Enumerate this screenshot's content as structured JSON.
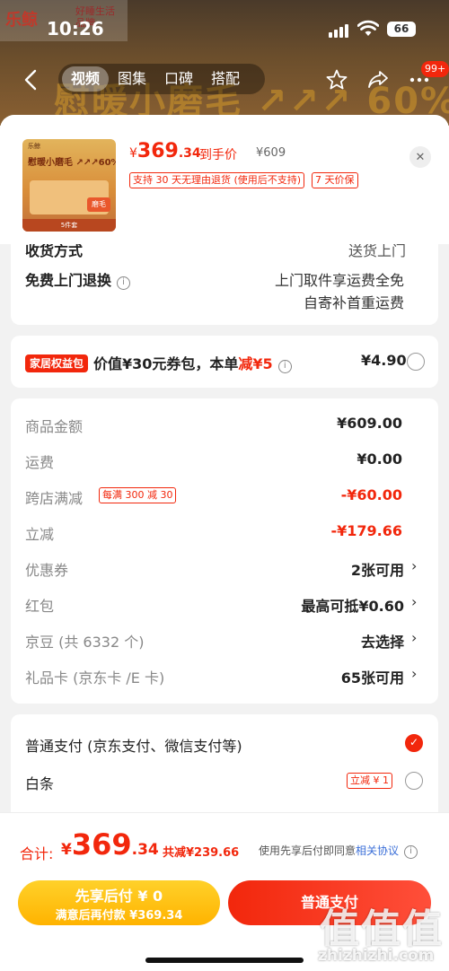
{
  "status_bar": {
    "time": "10:26",
    "battery": "66"
  },
  "background_page": {
    "brand_logo": "乐鲸",
    "brand_sub": "好睡生活品牌",
    "banner_text": "慰暖小磨毛 ↗↗↗ 60%",
    "tabs": [
      "视频",
      "图集",
      "口碑",
      "搭配"
    ],
    "active_tab": 0,
    "cart_badge": "99+"
  },
  "product": {
    "thumb_logo": "乐鲸",
    "thumb_title": "慰暖小磨毛 ↗↗↗60%",
    "thumb_tag": "磨毛",
    "thumb_bottom": "5件套",
    "price_currency": "¥",
    "price_int": "369",
    "price_dec": ".34",
    "price_suffix": "到手价",
    "original_price": "¥609",
    "tags": [
      "支持 30 天无理由退货 (使用后不支持)",
      "7 天价保"
    ]
  },
  "return_section": {
    "partial_label": "收货方式",
    "partial_value": "送货上门",
    "label": "免费上门退换",
    "info": "i",
    "value_line1": "上门取件享运费全免",
    "value_line2": "自寄补首重运费"
  },
  "benefit": {
    "badge": "家居权益包",
    "text_prefix": "价值¥30元券包，本单",
    "text_red": "减¥5",
    "info": "i",
    "price": "¥4.90"
  },
  "summary": [
    {
      "label": "商品金额",
      "value": "¥609.00",
      "tag": "",
      "red": false,
      "chevron": false
    },
    {
      "label": "运费",
      "value": "¥0.00",
      "tag": "",
      "red": false,
      "chevron": false
    },
    {
      "label": "跨店满减",
      "value": "-¥60.00",
      "tag": "每满 300 减 30",
      "red": true,
      "chevron": false
    },
    {
      "label": "立减",
      "value": "-¥179.66",
      "tag": "",
      "red": true,
      "chevron": false
    },
    {
      "label": "优惠券",
      "value": "2张可用",
      "tag": "",
      "red": false,
      "chevron": true
    },
    {
      "label": "红包",
      "value": "最高可抵¥0.60",
      "tag": "",
      "red": false,
      "chevron": true
    },
    {
      "label": "京豆 (共 6332 个)",
      "value": "去选择",
      "tag": "",
      "red": false,
      "chevron": true
    },
    {
      "label": "礼品卡 (京东卡 /E 卡)",
      "value": "65张可用",
      "tag": "",
      "red": false,
      "chevron": true
    }
  ],
  "payment": {
    "normal_label": "普通支付 (京东支付、微信支付等)",
    "baitiao_label": "白条",
    "baitiao_tag": "立减 ¥ 1"
  },
  "chevron_glyph": "›",
  "checkmark_glyph": "✓",
  "close_glyph": "✕",
  "bottom": {
    "total_label": "合计:",
    "total_currency": "¥",
    "total_int": "369",
    "total_dec": ".34",
    "saved": "共减¥239.66",
    "agree_prefix": "使用先享后付即同意",
    "agree_link": "相关协议",
    "info": "i",
    "later_line1": "先享后付 ¥ 0",
    "later_line2": "满意后再付款 ¥369.34",
    "normal_button": "普通支付"
  },
  "watermark": {
    "logo": "值值值",
    "text": "zhizhizhi.com"
  },
  "colors": {
    "accent": "#f2270c",
    "gold": "#ffb300",
    "link": "#3b6fd8"
  }
}
